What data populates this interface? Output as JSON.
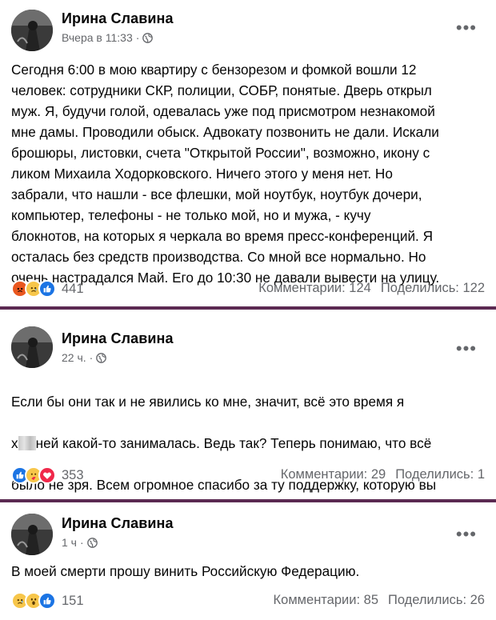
{
  "posts": [
    {
      "author": "Ирина Славина",
      "time": "Вчера в 11:33",
      "text": "Сегодня 6:00 в мою квартиру с бензорезом и фомкой вошли 12\nчеловек: сотрудники СКР, полиции, СОБР, понятые. Дверь  открыл\nмуж. Я, будучи голой, одевалась уже под присмотром незнакомой\nмне дамы. Проводили обыск. Адвокату позвонить не дали. Искали\nброшюры, листовки, счета \"Открытой России\", возможно, икону с\nликом Михаила Ходорковского. Ничего этого у меня нет. Но\nзабрали, что нашли - все флешки, мой ноутбук, ноутбук дочери,\nкомпьютер, телефоны - не только мой, но и мужа, - кучу\nблокнотов, на которых я  черкала во время пресс-конференций. Я\nосталась без средств производства. Со мной все нормально. Но\nочень настрадался Май. Его до 10:30 не давали вывести на улицу.",
      "reactions": [
        "angry",
        "sad",
        "like"
      ],
      "reaction_count": "441",
      "comments": "Комментарии: 124",
      "shares": "Поделились: 122"
    },
    {
      "author": "Ирина Славина",
      "time": "22 ч.",
      "text_line1": "Если бы они так и не явились ко мне, значит, всё это время я",
      "text_line2_before": "х",
      "text_line2_after": "ней какой-то занималась. Ведь так? Теперь понимаю, что всё",
      "text_rest": "было не зря. Всем огромное спасибо за ту поддержку, которую вы\nоказываете мне. Ваша капитанская дочка.",
      "reactions": [
        "like",
        "care",
        "love"
      ],
      "reaction_count": "353",
      "comments": "Комментарии: 29",
      "shares": "Поделились: 1"
    },
    {
      "author": "Ирина Славина",
      "time": "1 ч",
      "text": "В моей смерти прошу винить Российскую Федерацию.",
      "reactions": [
        "sad",
        "wow",
        "like"
      ],
      "reaction_count": "151",
      "comments": "Комментарии: 85",
      "shares": "Поделились: 26"
    }
  ],
  "colors": {
    "divider": "#5b2a52",
    "secondary_text": "#65676b",
    "like_blue": "#1b74e4"
  },
  "icons": {
    "more": "more-options-icon",
    "globe": "globe-icon",
    "angry": "angry-reaction-icon",
    "sad": "sad-reaction-icon",
    "like": "like-reaction-icon",
    "care": "care-reaction-icon",
    "love": "love-reaction-icon",
    "wow": "wow-reaction-icon"
  }
}
